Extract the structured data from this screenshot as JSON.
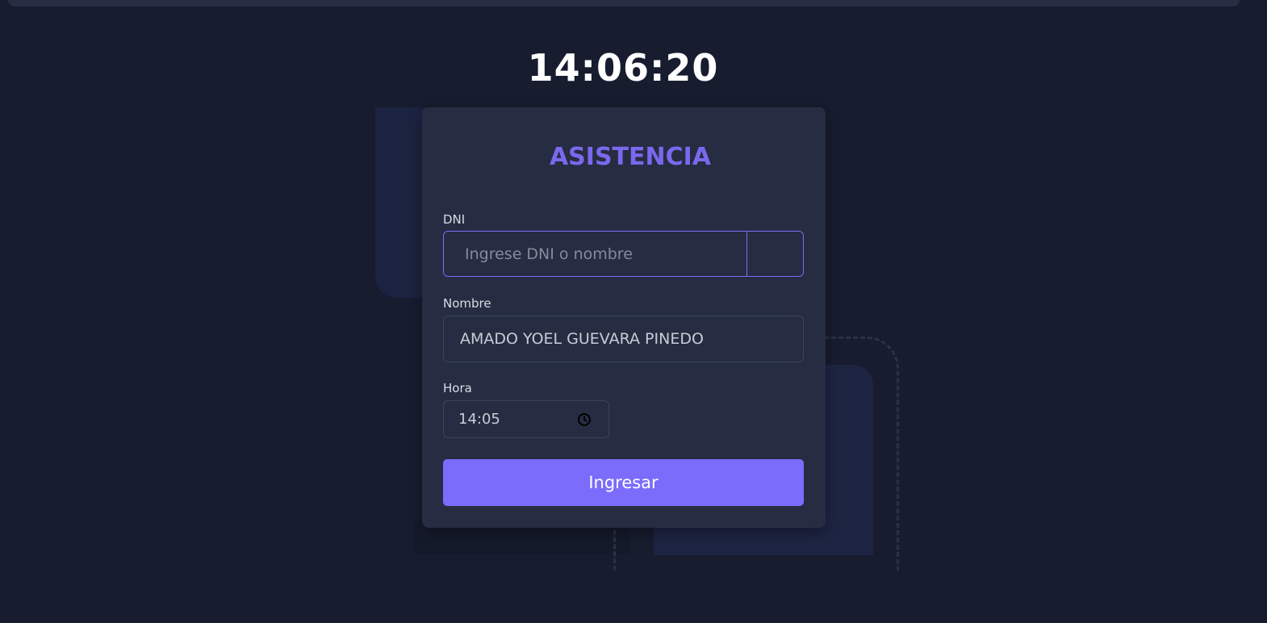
{
  "clock": {
    "time": "14:06:20"
  },
  "form": {
    "title": "ASISTENCIA",
    "dni": {
      "label": "DNI",
      "placeholder": "Ingrese DNI o nombre",
      "value": ""
    },
    "nombre": {
      "label": "Nombre",
      "value": "AMADO YOEL GUEVARA PINEDO"
    },
    "hora": {
      "label": "Hora",
      "value": "14:05",
      "icon": "clock-icon"
    },
    "submit_label": "Ingresar"
  },
  "colors": {
    "background": "#171c2f",
    "card": "#262d42",
    "accent": "#7b6cfc",
    "title": "#7b68ee"
  }
}
